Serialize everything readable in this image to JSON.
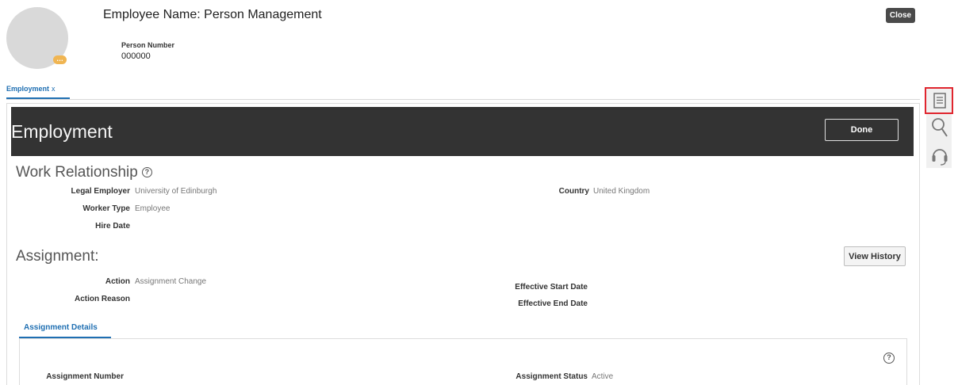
{
  "header": {
    "employee_name_label": "Employee Name:",
    "employee_name_value": "Person Management",
    "person_number_label": "Person Number",
    "person_number_value": "000000",
    "close_label": "Close",
    "avatar_badge": "…"
  },
  "tabs": [
    {
      "label": "Employment",
      "close": "x"
    }
  ],
  "banner": {
    "title": "Employment",
    "done_label": "Done"
  },
  "work_relationship": {
    "title": "Work Relationship",
    "help_glyph": "?",
    "legal_employer_label": "Legal Employer",
    "legal_employer_value": "University of Edinburgh",
    "country_label": "Country",
    "country_value": "United Kingdom",
    "worker_type_label": "Worker Type",
    "worker_type_value": "Employee",
    "hire_date_label": "Hire Date",
    "hire_date_value": ""
  },
  "assignment": {
    "title": "Assignment:",
    "view_history_label": "View History",
    "action_label": "Action",
    "action_value": "Assignment Change",
    "action_reason_label": "Action Reason",
    "action_reason_value": "",
    "effective_start_label": "Effective Start Date",
    "effective_start_value": "",
    "effective_end_label": "Effective End Date",
    "effective_end_value": ""
  },
  "assignment_details": {
    "tab_label": "Assignment Details",
    "help_glyph": "?",
    "assignment_number_label": "Assignment Number",
    "assignment_number_value": "",
    "assignment_status_label": "Assignment Status",
    "assignment_status_value": "Active"
  },
  "rail": {
    "icons": [
      "document-icon",
      "search-icon",
      "headset-icon"
    ],
    "highlight_color": "#e0252e"
  },
  "colors": {
    "banner_bg": "#333333",
    "accent": "#1f6fb2"
  }
}
